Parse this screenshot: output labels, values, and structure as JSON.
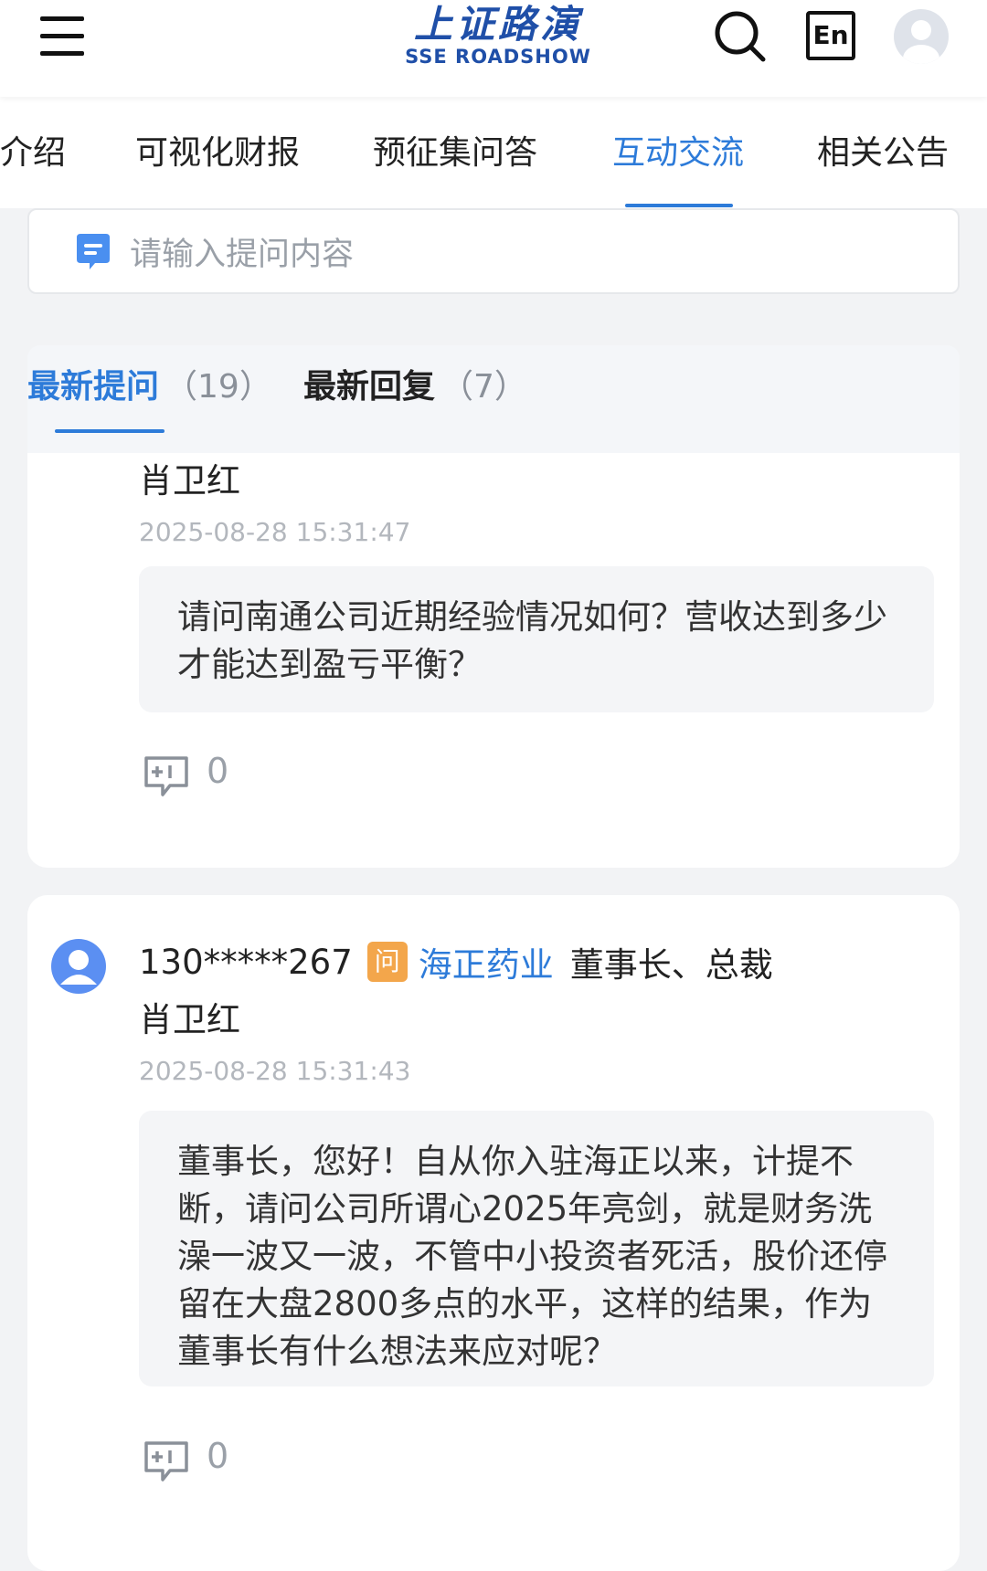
{
  "header": {
    "logo_cn": "上证路演",
    "logo_en": "SSE ROADSHOW",
    "lang_label": "En",
    "icons": [
      "menu-icon",
      "search-icon",
      "avatar"
    ]
  },
  "nav": {
    "tabs": [
      "介绍",
      "可视化财报",
      "预征集问答",
      "互动交流",
      "相关公告"
    ],
    "active_tab": "互动交流"
  },
  "ask_box": {
    "placeholder": "请输入提问内容"
  },
  "subtabs": {
    "latest_questions": {
      "label": "最新提问",
      "count": "（19）"
    },
    "latest_replies": {
      "label": "最新回复",
      "count": "（7）"
    },
    "active": "最新提问"
  },
  "questions": [
    {
      "person": "肖卫红",
      "time": "2025-08-28 15:31:47",
      "text": "请问南通公司近期经验情况如何？营收达到多少才能达到盈亏平衡？",
      "reply_count": "0"
    },
    {
      "user": "130*****267",
      "badge": "问",
      "company": "海正药业",
      "title": "董事长、总裁",
      "person": "肖卫红",
      "time": "2025-08-28 15:31:43",
      "text": "董事长，您好！自从你入驻海正以来，计提不断，请问公司所谓心2025年亮剑，就是财务洗澡一波又一波，不管中小投资者死活，股价还停留在大盘2800多点的水平，这样的结果，作为董事长有什么想法来应对呢？",
      "reply_count": "0"
    }
  ],
  "colors": {
    "accent": "#2d7bd9",
    "badge": "#f3a64b",
    "avatar": "#5b8ff2"
  }
}
